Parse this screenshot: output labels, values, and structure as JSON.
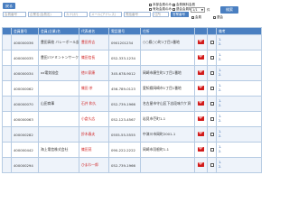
{
  "toolbar": {
    "back_label": "戻る",
    "fields": [
      "会員番号",
      "企業名(会員名)",
      "カナ(ｶﾅ)",
      "メール(アドレス)",
      "電話番号",
      "住所",
      "営業番号"
    ],
    "checkboxes": {
      "hq": "本部会員のみ",
      "valid": "有効会員のみ",
      "free": "会費無料会員",
      "exclude": "退会会員除外",
      "member": "会員",
      "extra": "退会"
    },
    "pager_value": "1/1",
    "pager_unit": "件",
    "search_label": "検索"
  },
  "table": {
    "headers": [
      "",
      "会員番号",
      "会員(企業)名",
      "代表者名",
      "電話番号",
      "住所",
      "",
      "",
      "備考"
    ],
    "rows": [
      {
        "no": "400000036",
        "company": "豊田高校 バレーボール部",
        "rep": "豊田秀吉",
        "tel": "0901201234",
        "addr": "○○県○○町1丁目1番地",
        "note": [
          "1.",
          "2."
        ]
      },
      {
        "no": "400000035",
        "company": "豊田バドミントンサークル",
        "rep": "織田信長",
        "tel": "052-333-1234",
        "addr": "",
        "note": [
          "1.",
          "2."
        ]
      },
      {
        "no": "400000034",
        "company": "xx電気協会",
        "rep": "徳川家康",
        "tel": "345-678-9012",
        "addr": "岡崎市康生町1丁目1番地",
        "note": [
          "1.",
          "2."
        ]
      },
      {
        "no": "400000062",
        "company": "",
        "rep": "織田 茶",
        "tel": "456-789-0123",
        "addr": "愛知県岡崎市1丁目1番地",
        "note": [
          "1.",
          "2."
        ]
      },
      {
        "no": "400000070",
        "company": "山田商事",
        "rep": "石井 和久",
        "tel": "052-739-1966",
        "addr": "名古屋市守山区下志段味穴ケ洞",
        "note": [
          "1.",
          "2."
        ]
      },
      {
        "no": "400000063",
        "company": "",
        "rep": "小倉久広",
        "tel": "052-123-4567",
        "addr": "岩見市壱町1-1",
        "note": [
          "1.",
          "2."
        ]
      },
      {
        "no": "400000282",
        "company": "",
        "rep": "鈴木春夫",
        "tel": "0555-55-5555",
        "addr": "中津川市岡町2001-1",
        "note": [
          "1.",
          "2."
        ]
      },
      {
        "no": "400000442",
        "company": "海上電信株式会社",
        "rep": "織田茂",
        "tel": "090-222-2222",
        "addr": "岡崎市羽根町1-1",
        "note": [
          "1.",
          "2."
        ]
      },
      {
        "no": "400000294",
        "company": "",
        "rep": "ひまわ一郎",
        "tel": "052-739-1966",
        "addr": "",
        "note": [
          "1.",
          "2."
        ]
      }
    ]
  },
  "colors": {
    "accent": "#4a7fc1",
    "mail": "#d11a1a",
    "rep_name": "#d02424"
  }
}
